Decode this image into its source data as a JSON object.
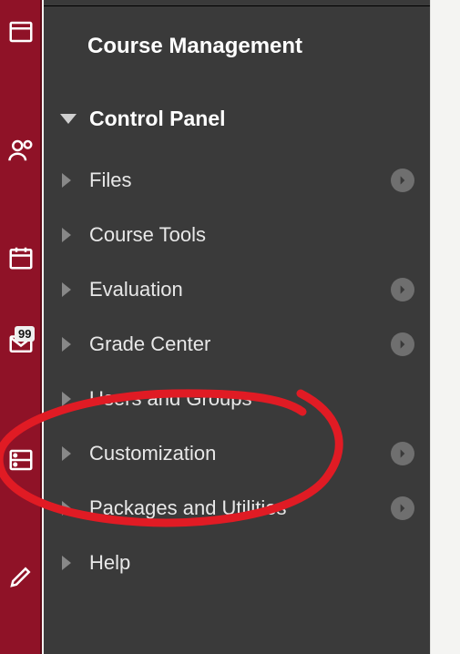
{
  "rail": {
    "badge": "99"
  },
  "panel": {
    "section_title": "Course Management",
    "header": "Control Panel",
    "items": [
      {
        "label": "Files",
        "has_arrow": true
      },
      {
        "label": "Course Tools",
        "has_arrow": false
      },
      {
        "label": "Evaluation",
        "has_arrow": true
      },
      {
        "label": "Grade Center",
        "has_arrow": true
      },
      {
        "label": "Users and Groups",
        "has_arrow": false
      },
      {
        "label": "Customization",
        "has_arrow": true
      },
      {
        "label": "Packages and Utilities",
        "has_arrow": true
      },
      {
        "label": "Help",
        "has_arrow": false
      }
    ]
  },
  "annotation": {
    "color": "#e01b24"
  }
}
